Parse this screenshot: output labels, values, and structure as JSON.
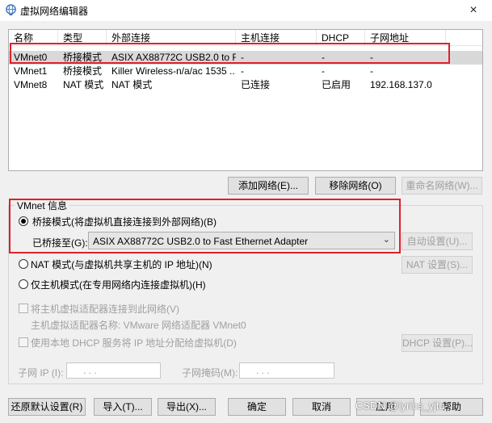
{
  "window": {
    "title": "虚拟网络编辑器",
    "close_icon": "×"
  },
  "table": {
    "headers": [
      "名称",
      "类型",
      "外部连接",
      "主机连接",
      "DHCP",
      "子网地址"
    ],
    "rows": [
      [
        "VMnet0",
        "桥接模式",
        "ASIX AX88772C USB2.0 to F...",
        "-",
        "-",
        "-"
      ],
      [
        "VMnet1",
        "桥接模式",
        "Killer Wireless-n/a/ac 1535 ...",
        "-",
        "-",
        "-"
      ],
      [
        "VMnet8",
        "NAT 模式",
        "NAT 模式",
        "已连接",
        "已启用",
        "192.168.137.0"
      ]
    ]
  },
  "table_buttons": {
    "add": "添加网络(E)...",
    "remove": "移除网络(O)",
    "rename": "重命名网络(W)..."
  },
  "vmnet_info": {
    "title": "VMnet 信息",
    "bridge_radio": "桥接模式(将虚拟机直接连接到外部网络)(B)",
    "bridged_to_label": "已桥接至(G):",
    "bridged_to_value": "ASIX AX88772C USB2.0 to Fast Ethernet Adapter",
    "auto_settings": "自动设置(U)...",
    "nat_radio": "NAT 模式(与虚拟机共享主机的 IP 地址)(N)",
    "nat_settings": "NAT 设置(S)...",
    "hostonly_radio": "仅主机模式(在专用网络内连接虚拟机)(H)",
    "connect_adapter_check": "将主机虚拟适配器连接到此网络(V)",
    "adapter_name": "主机虚拟适配器名称: VMware 网络适配器 VMnet0",
    "dhcp_check": "使用本地 DHCP 服务将 IP 地址分配给虚拟机(D)",
    "dhcp_settings": "DHCP 设置(P)...",
    "subnet_ip_label": "子网 IP (I):",
    "subnet_mask_label": "子网掩码(M):",
    "ip_dots": ".   .   ."
  },
  "bottom_buttons": {
    "restore": "还原默认设置(R)",
    "import": "导入(T)...",
    "export": "导出(X)...",
    "ok": "确定",
    "cancel": "取消",
    "apply": "应用",
    "help": "帮助"
  },
  "watermark": "CSDN @lyrics_yjtu"
}
